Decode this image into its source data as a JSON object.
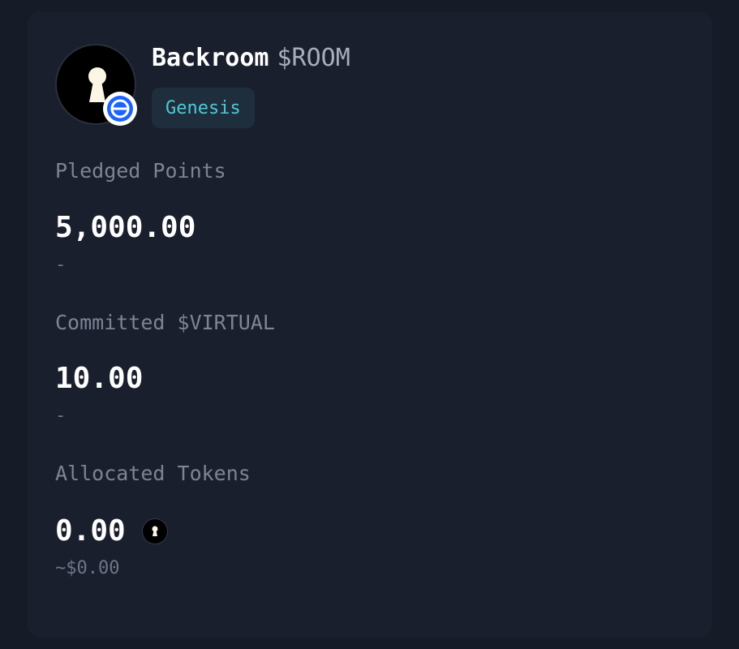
{
  "token": {
    "name": "Backroom",
    "symbol": "$ROOM",
    "badge": "Genesis",
    "avatar_icon": "keyhole-icon",
    "chain_icon": "base-chain-icon"
  },
  "stats": {
    "pledged": {
      "label": "Pledged Points",
      "value": "5,000.00",
      "sub": "-"
    },
    "committed": {
      "label": "Committed $VIRTUAL",
      "value": "10.00",
      "sub": "-"
    },
    "allocated": {
      "label": "Allocated Tokens",
      "value": "0.00",
      "sub": "~$0.00"
    }
  },
  "colors": {
    "page_bg": "#161b28",
    "card_bg": "#1a1f2e",
    "accent_teal": "#4fc8d6",
    "chain_blue": "#1e63ff"
  }
}
